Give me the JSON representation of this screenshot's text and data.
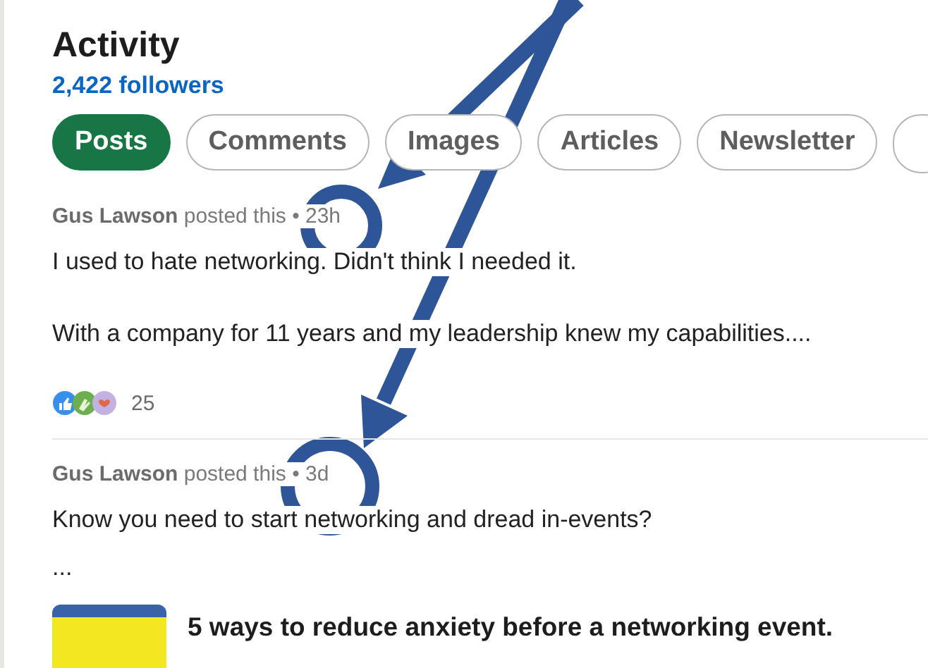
{
  "header": {
    "title": "Activity",
    "followers": "2,422 followers"
  },
  "filters": [
    {
      "label": "Posts",
      "selected": true
    },
    {
      "label": "Comments",
      "selected": false
    },
    {
      "label": "Images",
      "selected": false
    },
    {
      "label": "Articles",
      "selected": false
    },
    {
      "label": "Newsletter",
      "selected": false
    }
  ],
  "posts": [
    {
      "author": "Gus Lawson",
      "action": "posted this",
      "time": "• 23h",
      "paragraphs": [
        "I used to hate networking. Didn't think I needed it.",
        "With a company for 11 years and my leadership knew my capabilities...."
      ],
      "reactions": "25"
    },
    {
      "author": "Gus Lawson",
      "action": "posted this",
      "time": "• 3d",
      "paragraphs": [
        "Know you need to start networking and dread in-events?",
        "..."
      ],
      "article_title": "5 ways to reduce anxiety before a networking event."
    }
  ]
}
